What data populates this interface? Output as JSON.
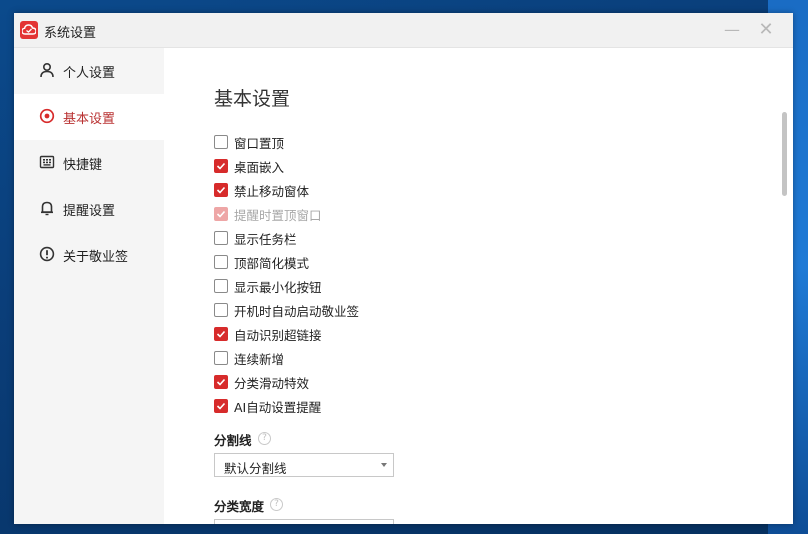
{
  "window": {
    "title": "系统设置",
    "minimize_icon": "minimize-icon",
    "close_icon": "close-icon"
  },
  "sidebar": {
    "items": [
      {
        "label": "个人设置",
        "icon": "user-icon",
        "active": false
      },
      {
        "label": "基本设置",
        "icon": "target-icon",
        "active": true
      },
      {
        "label": "快捷键",
        "icon": "keyboard-icon",
        "active": false
      },
      {
        "label": "提醒设置",
        "icon": "bell-icon",
        "active": false
      },
      {
        "label": "关于敬业签",
        "icon": "info-icon",
        "active": false
      }
    ]
  },
  "main": {
    "title": "基本设置",
    "options": [
      {
        "label": "窗口置顶",
        "checked": false,
        "disabled": false
      },
      {
        "label": "桌面嵌入",
        "checked": true,
        "disabled": false
      },
      {
        "label": "禁止移动窗体",
        "checked": true,
        "disabled": false
      },
      {
        "label": "提醒时置顶窗口",
        "checked": true,
        "disabled": true
      },
      {
        "label": "显示任务栏",
        "checked": false,
        "disabled": false
      },
      {
        "label": "顶部简化模式",
        "checked": false,
        "disabled": false
      },
      {
        "label": "显示最小化按钮",
        "checked": false,
        "disabled": false
      },
      {
        "label": "开机时自动启动敬业签",
        "checked": false,
        "disabled": false
      },
      {
        "label": "自动识别超链接",
        "checked": true,
        "disabled": false
      },
      {
        "label": "连续新增",
        "checked": false,
        "disabled": false
      },
      {
        "label": "分类滑动特效",
        "checked": true,
        "disabled": false
      },
      {
        "label": "AI自动设置提醒",
        "checked": true,
        "disabled": false
      }
    ],
    "divider": {
      "label": "分割线",
      "help": "?",
      "value": "默认分割线"
    },
    "category_width": {
      "label": "分类宽度",
      "help": "?"
    }
  },
  "colors": {
    "accent": "#d72b2b",
    "active_text": "#b93232"
  }
}
